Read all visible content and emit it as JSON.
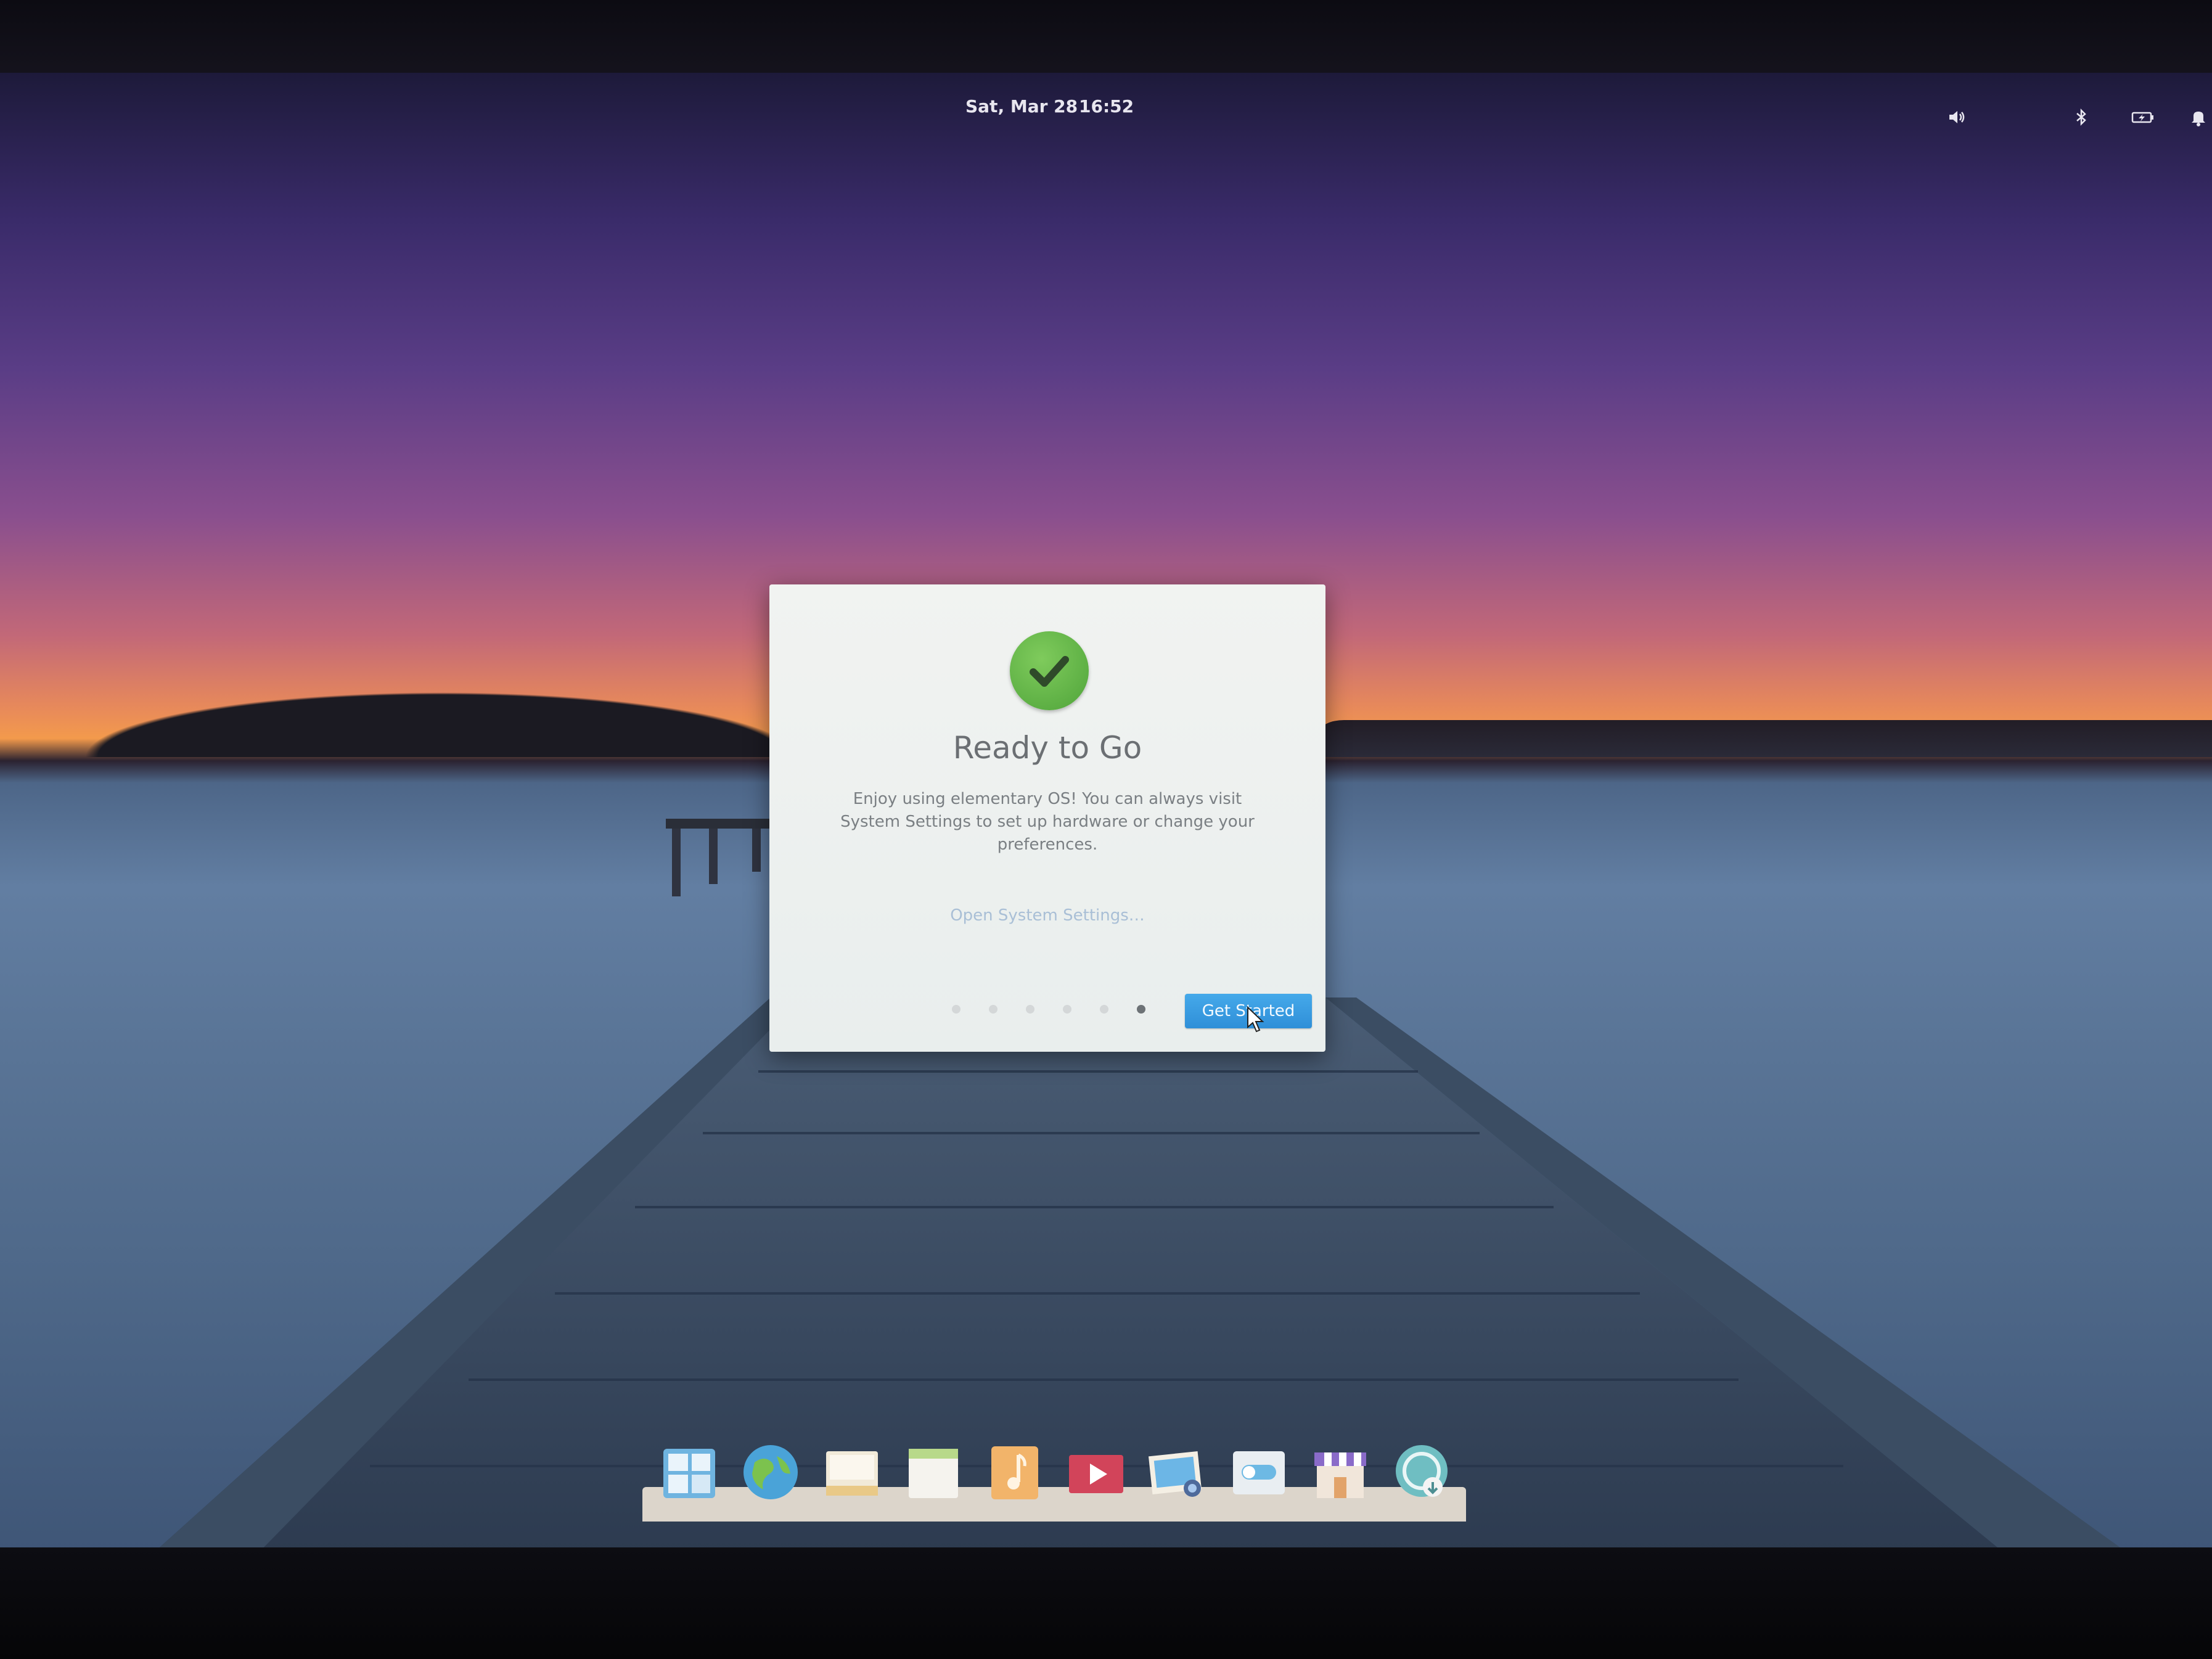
{
  "panel": {
    "date": "Sat, Mar 28",
    "time": "16:52",
    "indicators": [
      "volume-icon",
      "bluetooth-icon",
      "battery-icon",
      "notifications-icon"
    ]
  },
  "dialog": {
    "title": "Ready to Go",
    "body": "Enjoy using elementary OS! You can always visit System Settings to set up hardware or change your preferences.",
    "link": "Open System Settings…",
    "page_count": 6,
    "current_page": 6,
    "primary_button": "Get Started",
    "accent_color": "#3a9de2",
    "success_color": "#5fb446"
  },
  "dock": {
    "items": [
      "multitasking-view-icon",
      "web-browser-icon",
      "mail-icon",
      "calendar-icon",
      "music-icon",
      "videos-icon",
      "photos-icon",
      "system-settings-icon",
      "appcenter-icon",
      "installer-icon"
    ]
  }
}
